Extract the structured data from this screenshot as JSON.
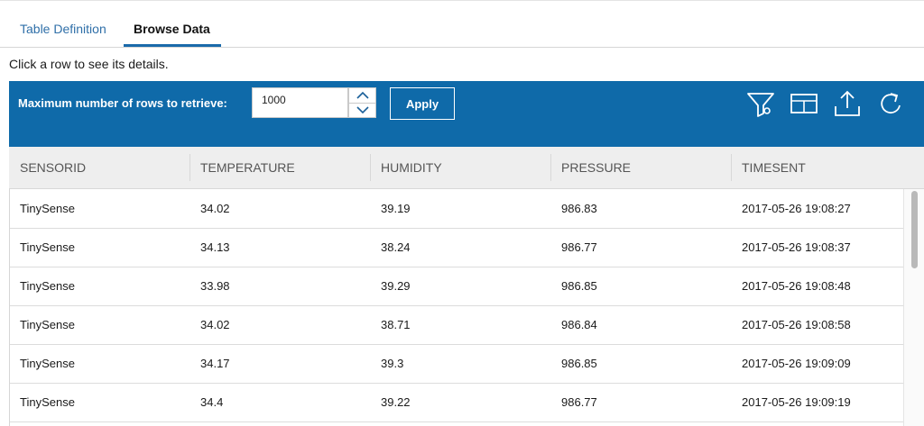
{
  "tabs": [
    {
      "label": "Table Definition",
      "active": false
    },
    {
      "label": "Browse Data",
      "active": true
    }
  ],
  "hint": "Click a row to see its details.",
  "toolbar": {
    "max_rows_label": "Maximum number of rows to retrieve:",
    "max_rows_value": "1000",
    "apply_label": "Apply",
    "icons": [
      "filter-icon",
      "columns-icon",
      "export-icon",
      "refresh-icon"
    ],
    "background_color": "#0f6aa9"
  },
  "table": {
    "columns": [
      "SENSORID",
      "TEMPERATURE",
      "HUMIDITY",
      "PRESSURE",
      "TIMESENT"
    ],
    "rows": [
      [
        "TinySense",
        "34.02",
        "39.19",
        "986.83",
        "2017-05-26 19:08:27"
      ],
      [
        "TinySense",
        "34.13",
        "38.24",
        "986.77",
        "2017-05-26 19:08:37"
      ],
      [
        "TinySense",
        "33.98",
        "39.29",
        "986.85",
        "2017-05-26 19:08:48"
      ],
      [
        "TinySense",
        "34.02",
        "38.71",
        "986.84",
        "2017-05-26 19:08:58"
      ],
      [
        "TinySense",
        "34.17",
        "39.3",
        "986.85",
        "2017-05-26 19:09:09"
      ],
      [
        "TinySense",
        "34.4",
        "39.22",
        "986.77",
        "2017-05-26 19:09:19"
      ]
    ]
  }
}
